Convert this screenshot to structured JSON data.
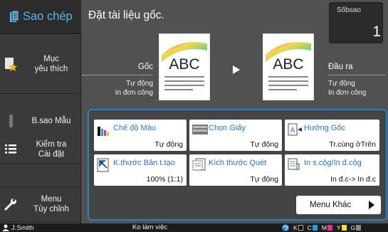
{
  "sidebar": {
    "title": "Sao chép",
    "items": [
      {
        "id": "fav",
        "label_line1": "Mục",
        "label_line2": "yêu thích",
        "icon": "favorite-star-icon"
      },
      {
        "id": "bsao",
        "label": "B.sao Mẫu"
      },
      {
        "id": "check",
        "label_line1": "Kiểm tra",
        "label_line2": "Cài đặt",
        "icon": "list-icon"
      },
      {
        "id": "custom",
        "label_line1": "Menu",
        "label_line2": "Tùy chỉnh",
        "icon": "wrench-icon"
      }
    ]
  },
  "main": {
    "status": "Đặt tài liệu gốc.",
    "copies": {
      "label": "Sốbsao",
      "value": "1"
    },
    "original": {
      "title": "Gốc",
      "line1": "Tự động",
      "line2": "In đơn công",
      "preview_text": "ABC"
    },
    "output": {
      "title": "Đầu ra",
      "line1": "Tự động",
      "line2": "In đơn công",
      "preview_text": "ABC"
    },
    "functions": [
      {
        "id": "color",
        "name": "Chế độ Màu",
        "value": "Tự động",
        "icon": "color-mode-icon"
      },
      {
        "id": "paper",
        "name": "Chọn Giấy",
        "value": "Tự động",
        "icon": "paper-tray-icon"
      },
      {
        "id": "orient",
        "name": "Hướng Gốc",
        "value": "Tr.cùng ởTrên",
        "icon": "orientation-icon"
      },
      {
        "id": "scan",
        "name": "K.thước Bản t.tạo",
        "value": "100% (1:1)",
        "icon": "reproduction-size-icon"
      },
      {
        "id": "scansize",
        "name": "Kích thước Quét",
        "value": "Tự động",
        "icon": "scan-size-icon"
      },
      {
        "id": "duplex",
        "name": "In s.cộg/In đ.cộg",
        "value": "In đ.c-> In đ.c",
        "icon": "duplex-icon"
      }
    ],
    "more_label": "Menu Khác"
  },
  "bottom": {
    "user": "J.Smith",
    "state": "Ko làm việc",
    "inks": [
      {
        "label": "K",
        "color": "#000000"
      },
      {
        "label": "C",
        "color": "#19a3dc"
      },
      {
        "label": "M",
        "color": "#e0318f"
      },
      {
        "label": "Y",
        "color": "#f3e21b"
      },
      {
        "label": "G",
        "color": "#8a8a8a"
      }
    ]
  },
  "colors": {
    "accent": "#2c7fc6",
    "title": "#5ab4e6"
  }
}
